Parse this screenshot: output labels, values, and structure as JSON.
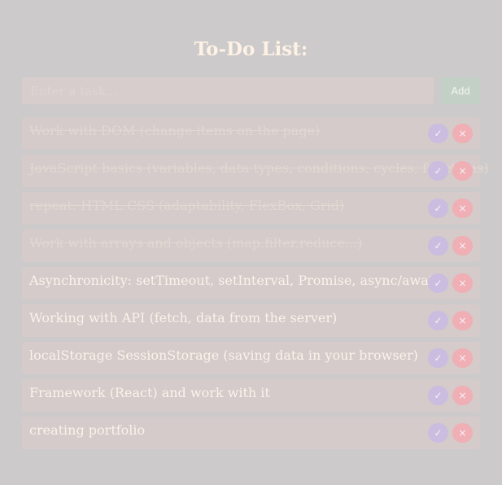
{
  "header": {
    "title": "To-Do List:"
  },
  "form": {
    "placeholder": "Enter a task...",
    "add_label": "Add"
  },
  "icons": {
    "check": "✓",
    "delete": "×"
  },
  "colors": {
    "background": "#cdcacb",
    "item_background": "#d4cbca",
    "check_button": "#cabde0",
    "delete_button": "#f0afb4",
    "add_button": "#c2d0c5"
  },
  "tasks": [
    {
      "text": "Work with DOM (change items on the page)",
      "done": true
    },
    {
      "text": "JavaScript basics (variables, data types, conditions, cycles, functions)",
      "done": true
    },
    {
      "text": "repeat: HTML CSS (adaptability, FlexBox, Grid)",
      "done": true
    },
    {
      "text": "Work with arrays and objects (map,filter,reduce...)",
      "done": true
    },
    {
      "text": "Asynchronicity: setTimeout, setInterval, Promise, async/await",
      "done": false
    },
    {
      "text": "Working with API (fetch, data from the server)",
      "done": false
    },
    {
      "text": "localStorage SessionStorage (saving data in your browser)",
      "done": false
    },
    {
      "text": "Framework (React) and work with it",
      "done": false
    },
    {
      "text": "creating portfolio",
      "done": false
    }
  ]
}
